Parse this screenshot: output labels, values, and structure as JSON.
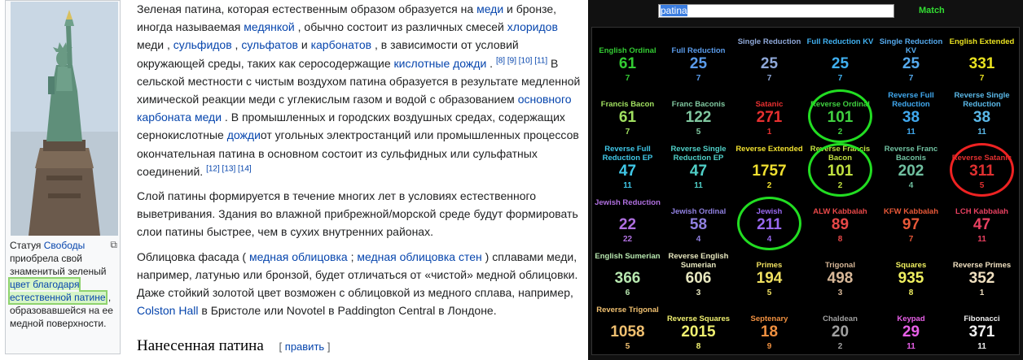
{
  "article": {
    "caption": {
      "t1": "Статуя ",
      "link1": "Свободы",
      "t2": " приобрела свой знаменитый зеленый ",
      "highlight": "цвет благодаря естественной патине",
      "t3": " , образовавшейся на ее медной поверхности."
    },
    "p1": [
      {
        "t": "Зеленая патина, которая естественным образом образуется на "
      },
      {
        "a": "меди"
      },
      {
        "t": " и бронзе, иногда называемая "
      },
      {
        "a": "медянкой"
      },
      {
        "t": " , обычно состоит из различных смесей "
      },
      {
        "a": "хлоридов"
      },
      {
        "t": " меди , "
      },
      {
        "a": "сульфидов"
      },
      {
        "t": " , "
      },
      {
        "a": "сульфатов"
      },
      {
        "t": " и "
      },
      {
        "a": "карбонатов"
      },
      {
        "t": " , в зависимости от условий окружающей среды, таких как серосодержащие "
      },
      {
        "a": "кислотные дожди"
      },
      {
        "t": " . "
      },
      {
        "s": "[8] [9] [10] [11]"
      },
      {
        "t": " В сельской местности с чистым воздухом патина образуется в результате медленной химической реакции меди с углекислым газом и водой с образованием "
      },
      {
        "a": "основного карбоната меди"
      },
      {
        "t": " . В промышленных и городских воздушных средах, содержащих сернокислотные "
      },
      {
        "a": "дожди"
      },
      {
        "t": "от угольных электростанций или промышленных процессов окончательная патина в основном состоит из сульфидных или сульфатных соединений. "
      },
      {
        "s": "[12] [13] [14]"
      }
    ],
    "p2": [
      {
        "t": "Слой патины формируется в течение многих лет в условиях естественного выветривания. Здания во влажной прибрежной/морской среде будут формировать слои патины быстрее, чем в сухих внутренних районах."
      }
    ],
    "p3": [
      {
        "t": "Облицовка фасада ( "
      },
      {
        "a": "медная облицовка"
      },
      {
        "t": " ; "
      },
      {
        "a": "медная облицовка стен"
      },
      {
        "t": " ) сплавами меди, например, латунью или бронзой, будет отличаться от «чистой» медной облицовки. Даже стойкий золотой цвет возможен с облицовкой из медного сплава, например, "
      },
      {
        "a": "Colston Hall"
      },
      {
        "t": " в Бристоле или Novotel в Paddington Central в Лондоне."
      }
    ],
    "section_heading": "Нанесенная патина",
    "edit_open": "[",
    "edit_label": "править",
    "edit_close": "]"
  },
  "calculator": {
    "search_value": "patina",
    "match_label": "Match",
    "ciphers": [
      {
        "name": "English Ordinal",
        "value": "61",
        "reduced": "7",
        "color": "#33cc33"
      },
      {
        "name": "Full Reduction",
        "value": "25",
        "reduced": "7",
        "color": "#5a9bea"
      },
      {
        "name": "Single Reduction",
        "value": "25",
        "reduced": "7",
        "color": "#8fa8d8"
      },
      {
        "name": "Full Reduction KV",
        "value": "25",
        "reduced": "7",
        "color": "#40b0f0"
      },
      {
        "name": "Single Reduction KV",
        "value": "25",
        "reduced": "7",
        "color": "#55aaee"
      },
      {
        "name": "English Extended",
        "value": "331",
        "reduced": "7",
        "color": "#e8e020"
      },
      {
        "name": "Francis Bacon",
        "value": "61",
        "reduced": "7",
        "color": "#a0e060"
      },
      {
        "name": "Franc Baconis",
        "value": "122",
        "reduced": "5",
        "color": "#80c8a0"
      },
      {
        "name": "Satanic",
        "value": "271",
        "reduced": "1",
        "color": "#e83030"
      },
      {
        "name": "Reverse Ordinal",
        "value": "101",
        "reduced": "2",
        "color": "#40d040"
      },
      {
        "name": "Reverse Full Reduction",
        "value": "38",
        "reduced": "11",
        "color": "#40a8ee"
      },
      {
        "name": "Reverse Single Reduction",
        "value": "38",
        "reduced": "11",
        "color": "#5ab8e8"
      },
      {
        "name": "Reverse Full Reduction EP",
        "value": "47",
        "reduced": "11",
        "color": "#40c8e8"
      },
      {
        "name": "Reverse Single Reduction EP",
        "value": "47",
        "reduced": "11",
        "color": "#50d0c8"
      },
      {
        "name": "Reverse Extended",
        "value": "1757",
        "reduced": "2",
        "color": "#f0e030"
      },
      {
        "name": "Reverse Francis Bacon",
        "value": "101",
        "reduced": "2",
        "color": "#c0e040"
      },
      {
        "name": "Reverse Franc Baconis",
        "value": "202",
        "reduced": "4",
        "color": "#70c0a0"
      },
      {
        "name": "Reverse Satanic",
        "value": "311",
        "reduced": "5",
        "color": "#e03030"
      },
      {
        "name": "Jewish Reduction",
        "value": "22",
        "reduced": "22",
        "color": "#b070e0"
      },
      {
        "name": "Jewish Ordinal",
        "value": "58",
        "reduced": "4",
        "color": "#9080e0"
      },
      {
        "name": "Jewish",
        "value": "211",
        "reduced": "4",
        "color": "#9868f0"
      },
      {
        "name": "ALW Kabbalah",
        "value": "89",
        "reduced": "8",
        "color": "#e84848"
      },
      {
        "name": "KFW Kabbalah",
        "value": "97",
        "reduced": "7",
        "color": "#e85838"
      },
      {
        "name": "LCH Kabbalah",
        "value": "47",
        "reduced": "11",
        "color": "#e84060"
      },
      {
        "name": "English Sumerian",
        "value": "366",
        "reduced": "6",
        "color": "#b8e8b0"
      },
      {
        "name": "Reverse English Sumerian",
        "value": "606",
        "reduced": "3",
        "color": "#e8e8c0"
      },
      {
        "name": "Primes",
        "value": "194",
        "reduced": "5",
        "color": "#f0e060"
      },
      {
        "name": "Trigonal",
        "value": "498",
        "reduced": "3",
        "color": "#d8b898"
      },
      {
        "name": "Squares",
        "value": "935",
        "reduced": "8",
        "color": "#f0f060"
      },
      {
        "name": "Reverse Primes",
        "value": "352",
        "reduced": "1",
        "color": "#f0e0c0"
      },
      {
        "name": "Reverse Trigonal",
        "value": "1058",
        "reduced": "5",
        "color": "#f0c070"
      },
      {
        "name": "Reverse Squares",
        "value": "2015",
        "reduced": "8",
        "color": "#f0f070"
      },
      {
        "name": "Septenary",
        "value": "18",
        "reduced": "9",
        "color": "#f09040"
      },
      {
        "name": "Chaldean",
        "value": "20",
        "reduced": "2",
        "color": "#a0a0a0"
      },
      {
        "name": "Keypad",
        "value": "29",
        "reduced": "11",
        "color": "#e860e8"
      },
      {
        "name": "Fibonacci",
        "value": "371",
        "reduced": "11",
        "color": "#f0f0f0"
      }
    ],
    "circles": [
      {
        "cipher": "Reverse Ordinal",
        "color": "#22dd22"
      },
      {
        "cipher": "Reverse Francis Bacon",
        "color": "#22dd22"
      },
      {
        "cipher": "Jewish",
        "color": "#22dd22"
      },
      {
        "cipher": "Reverse Satanic",
        "color": "#ee2222"
      }
    ]
  }
}
